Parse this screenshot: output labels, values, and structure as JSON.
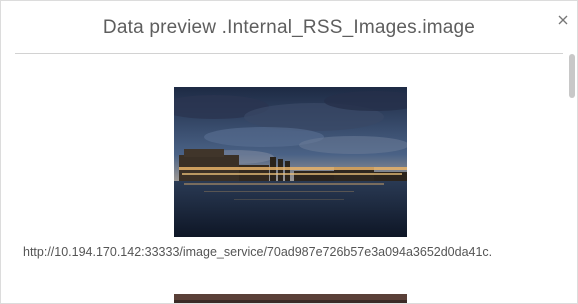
{
  "dialog": {
    "title": "Data preview .Internal_RSS_Images.image",
    "close_icon": "close-icon"
  },
  "images": [
    {
      "url": "http://10.194.170.142:33333/image_service/70ad987e726b57e3a094a3652d0da41c."
    }
  ],
  "colors": {
    "title": "#5e5e5e",
    "url": "#555555",
    "divider": "#d2d2d2",
    "scroll_thumb": "#c8c8c8"
  }
}
